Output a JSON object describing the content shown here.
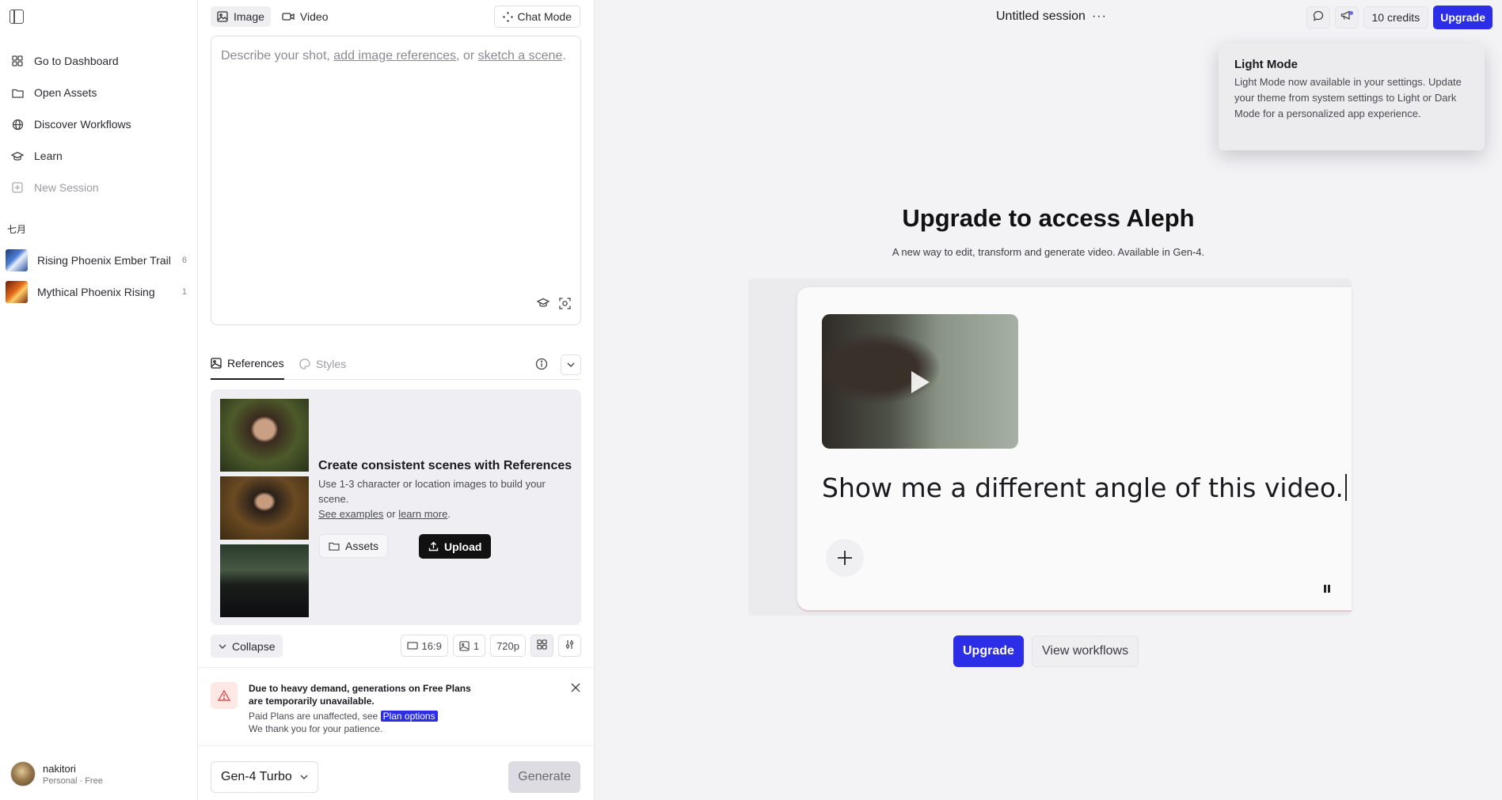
{
  "sidebar": {
    "nav": [
      {
        "label": "Go to Dashboard",
        "icon": "grid-icon"
      },
      {
        "label": "Open Assets",
        "icon": "folder-icon"
      },
      {
        "label": "Discover Workflows",
        "icon": "globe-icon"
      },
      {
        "label": "Learn",
        "icon": "graduation-cap-icon"
      },
      {
        "label": "New Session",
        "icon": "plus-square-icon"
      }
    ],
    "month": "七月",
    "sessions": [
      {
        "name": "Rising Phoenix Ember Trail",
        "count": "6"
      },
      {
        "name": "Mythical Phoenix Rising",
        "count": "1"
      }
    ],
    "user": {
      "name": "nakitori",
      "plan": "Personal · Free"
    }
  },
  "composer": {
    "tabs": [
      {
        "label": "Image",
        "icon": "image-icon"
      },
      {
        "label": "Video",
        "icon": "video-icon"
      }
    ],
    "chat_mode": "Chat Mode",
    "prompt": {
      "part1": "Describe your shot, ",
      "link1": "add image references",
      "part2": ", or ",
      "link2": "sketch a scene",
      "part3": "."
    },
    "ref_tabs": {
      "references": "References",
      "styles": "Styles"
    },
    "ref_card": {
      "title": "Create consistent scenes with References",
      "description": "Use 1-3 character or location images to build your scene.",
      "see_examples": "See examples",
      "or": " or ",
      "learn_more": "learn more",
      "period": ".",
      "assets_button": "Assets",
      "upload_button": "Upload"
    },
    "options": {
      "collapse": "Collapse",
      "aspect": "16:9",
      "count": "1",
      "resolution": "720p"
    },
    "notice": {
      "title": "Due to heavy demand, generations on Free Plans are temporarily unavailable.",
      "body1": "Paid Plans are unaffected, see ",
      "plan_link": "Plan options",
      "body2": "We thank you for your patience."
    },
    "model": "Gen-4 Turbo",
    "generate": "Generate"
  },
  "main": {
    "session_title": "Untitled session",
    "session_menu": "···",
    "credits": "10 credits",
    "upgrade": "Upgrade",
    "tooltip": {
      "title": "Light Mode",
      "body": "Light Mode now available in your settings. Update your theme from system settings to Light or Dark Mode for a personalized app experience."
    },
    "hero": {
      "title": "Upgrade to access Aleph",
      "subtitle": "A new way to edit, transform and generate video. Available in Gen-4."
    },
    "demo": {
      "text": "Show me a different angle of this video."
    },
    "cta": {
      "upgrade": "Upgrade",
      "workflows": "View workflows"
    }
  },
  "colors": {
    "accent": "#2b2ee6",
    "warning_bg": "#fde8e6"
  }
}
